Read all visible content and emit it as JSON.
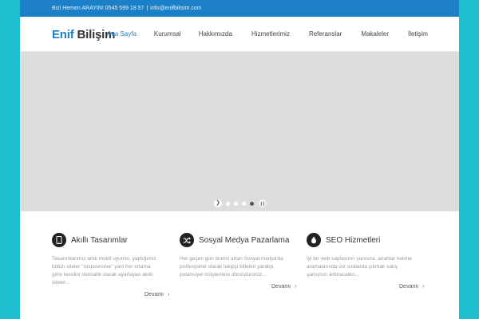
{
  "topbar": {
    "phone_text": "Bizi Hemen ARAYIN! 0545 599 18 57",
    "separator": "|",
    "email": "info@enifbilisim.com"
  },
  "header": {
    "logo_part1": "Enif",
    "logo_part2": "Bilişim"
  },
  "nav": {
    "items": [
      {
        "label": "Ana Sayfa",
        "active": true
      },
      {
        "label": "Kurumsal"
      },
      {
        "label": "Hakkımızda"
      },
      {
        "label": "Hizmetlerimiz"
      },
      {
        "label": "Referanslar"
      },
      {
        "label": "Makaleler"
      },
      {
        "label": "İletişim"
      }
    ]
  },
  "slider": {
    "prev_glyph": "❯",
    "dots": 4,
    "active_dot": 4
  },
  "features": [
    {
      "icon": "tablet-icon",
      "title": "Akıllı Tasarımlar",
      "lines": [
        "Tasarımlarımız artık mobil uyumlu, yaptığımız",
        "bütün siteler \"resposnsive\" yani her ortama",
        "göre kendini otomatik olarak ayarlayan akıllı",
        "siteler..."
      ],
      "more": "Devamı"
    },
    {
      "icon": "shuffle-icon",
      "title": "Sosyal Medya Pazarlama",
      "lines": [
        "Her geçen gün önemi artan Sosyal medya'da",
        "profesyonel olarak takipçi kitleleri yaratıp,",
        "potansiyel müşterilere dönüştürürüz..."
      ],
      "more": "Devamı"
    },
    {
      "icon": "drop-icon",
      "title": "SEO Hizmetleri",
      "lines": [
        "İyi bir web sayfasının yanısıra, anahtar kelime",
        "aramalarında üst sıralarda çıkmak satış",
        "şansınızı arttıracaktır..."
      ],
      "more": "Devamı"
    }
  ],
  "colors": {
    "background": "#1cbfd0",
    "topbar": "#1b80c8",
    "accent": "#1b80c8",
    "slider": "#dddddd",
    "icon_circle": "#222222"
  }
}
